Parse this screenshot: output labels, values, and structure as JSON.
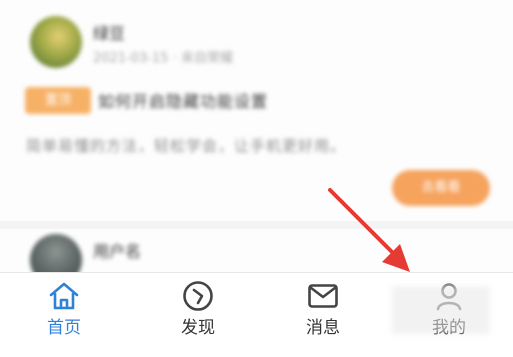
{
  "feed": {
    "posts": [
      {
        "username": "绿豆",
        "meta": "2021-03-15 · 来自荣耀",
        "tag": "置顶",
        "title": "如何开启隐藏功能设置",
        "body": "简单易懂的方法，轻松学会，让手机更好用。",
        "action_button": "去看看"
      },
      {
        "username": "用户名"
      }
    ]
  },
  "tabbar": {
    "tabs": [
      {
        "label": "首页",
        "icon": "home-icon",
        "active": true
      },
      {
        "label": "发现",
        "icon": "compass-icon",
        "active": false
      },
      {
        "label": "消息",
        "icon": "envelope-icon",
        "active": false
      },
      {
        "label": "我的",
        "icon": "user-icon",
        "active": false
      }
    ]
  },
  "colors": {
    "active_tab": "#2f80d8",
    "tag_orange": "#f7b166",
    "button_orange": "#f6a35e",
    "arrow_red": "#e53b35"
  }
}
